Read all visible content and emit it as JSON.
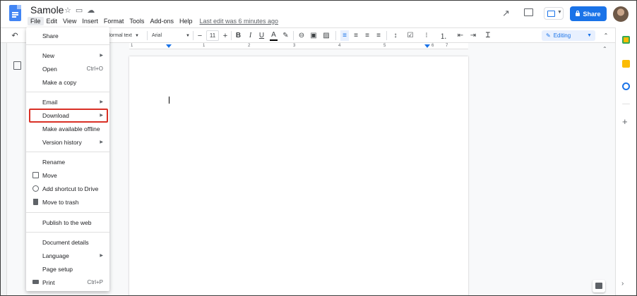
{
  "window": {
    "doc_title": "Samole",
    "menu": [
      "File",
      "Edit",
      "View",
      "Insert",
      "Format",
      "Tools",
      "Add-ons",
      "Help"
    ],
    "last_edit": "Last edit was 6 minutes ago",
    "share_label": "Share"
  },
  "toolbar": {
    "style_value": "Normal text",
    "font_value": "Arial",
    "size_value": "11",
    "minus": "−",
    "plus": "+",
    "bold": "B",
    "italic": "I",
    "underline": "U",
    "text_color": "A",
    "editing_mode": "Editing"
  },
  "ruler": {
    "ticks": [
      "1",
      "1",
      "2",
      "3",
      "4",
      "5",
      "6",
      "7"
    ]
  },
  "file_menu": {
    "items": [
      {
        "label": "Share",
        "shortcut": "",
        "submenu": false
      },
      {
        "label": "New",
        "shortcut": "",
        "submenu": true
      },
      {
        "label": "Open",
        "shortcut": "Ctrl+O",
        "submenu": false
      },
      {
        "label": "Make a copy",
        "shortcut": "",
        "submenu": false
      },
      {
        "label": "Email",
        "shortcut": "",
        "submenu": true
      },
      {
        "label": "Download",
        "shortcut": "",
        "submenu": true
      },
      {
        "label": "Make available offline",
        "shortcut": "",
        "submenu": false
      },
      {
        "label": "Version history",
        "shortcut": "",
        "submenu": true
      },
      {
        "label": "Rename",
        "shortcut": "",
        "submenu": false
      },
      {
        "label": "Move",
        "shortcut": "",
        "submenu": false
      },
      {
        "label": "Add shortcut to Drive",
        "shortcut": "",
        "submenu": false
      },
      {
        "label": "Move to trash",
        "shortcut": "",
        "submenu": false
      },
      {
        "label": "Publish to the web",
        "shortcut": "",
        "submenu": false
      },
      {
        "label": "Document details",
        "shortcut": "",
        "submenu": false
      },
      {
        "label": "Language",
        "shortcut": "",
        "submenu": true
      },
      {
        "label": "Page setup",
        "shortcut": "",
        "submenu": false
      },
      {
        "label": "Print",
        "shortcut": "Ctrl+P",
        "submenu": false
      }
    ],
    "highlighted_item": "Download"
  },
  "colors": {
    "accent": "#1a73e8",
    "highlight_border": "#d93025"
  }
}
